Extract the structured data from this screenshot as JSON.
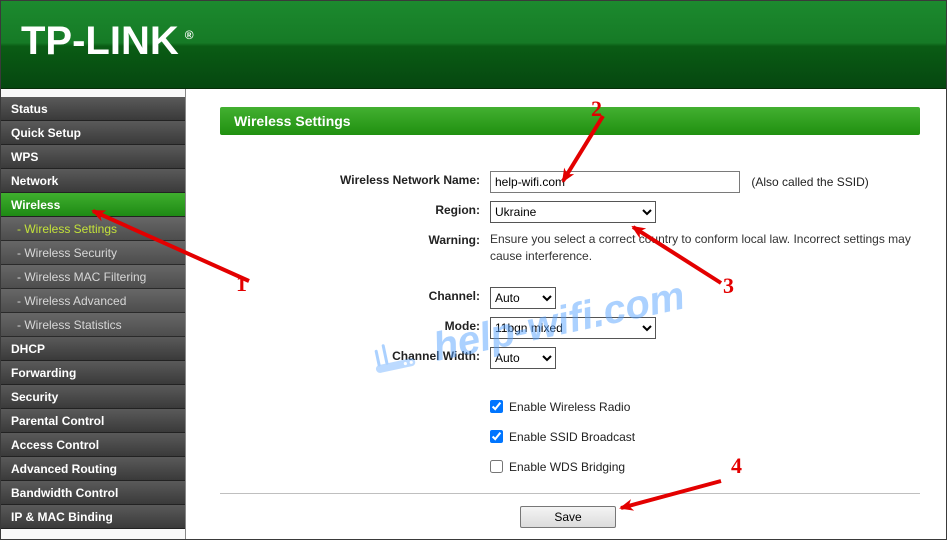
{
  "brand": "TP-LINK",
  "sidebar": {
    "items": [
      {
        "label": "Status"
      },
      {
        "label": "Quick Setup"
      },
      {
        "label": "WPS"
      },
      {
        "label": "Network"
      },
      {
        "label": "Wireless",
        "active": true,
        "sub": [
          {
            "label": "- Wireless Settings",
            "active": true
          },
          {
            "label": "- Wireless Security"
          },
          {
            "label": "- Wireless MAC Filtering"
          },
          {
            "label": "- Wireless Advanced"
          },
          {
            "label": "- Wireless Statistics"
          }
        ]
      },
      {
        "label": "DHCP"
      },
      {
        "label": "Forwarding"
      },
      {
        "label": "Security"
      },
      {
        "label": "Parental Control"
      },
      {
        "label": "Access Control"
      },
      {
        "label": "Advanced Routing"
      },
      {
        "label": "Bandwidth Control"
      },
      {
        "label": "IP & MAC Binding"
      }
    ]
  },
  "panel": {
    "heading": "Wireless Settings",
    "labels": {
      "ssid": "Wireless Network Name:",
      "region": "Region:",
      "warning": "Warning:",
      "channel": "Channel:",
      "mode": "Mode:",
      "width": "Channel Width:"
    },
    "values": {
      "ssid": "help-wifi.com",
      "ssid_note": "(Also called the SSID)",
      "region": "Ukraine",
      "warning_text": "Ensure you select a correct country to conform local law. Incorrect settings may cause interference.",
      "channel": "Auto",
      "mode": "11bgn mixed",
      "width": "Auto"
    },
    "checkboxes": {
      "radio": {
        "label": "Enable Wireless Radio",
        "checked": true
      },
      "ssid_broadcast": {
        "label": "Enable SSID Broadcast",
        "checked": true
      },
      "wds": {
        "label": "Enable WDS Bridging",
        "checked": false
      }
    },
    "save_label": "Save"
  },
  "annotations": {
    "n1": "1",
    "n2": "2",
    "n3": "3",
    "n4": "4"
  },
  "watermark": "help-wifi.com"
}
